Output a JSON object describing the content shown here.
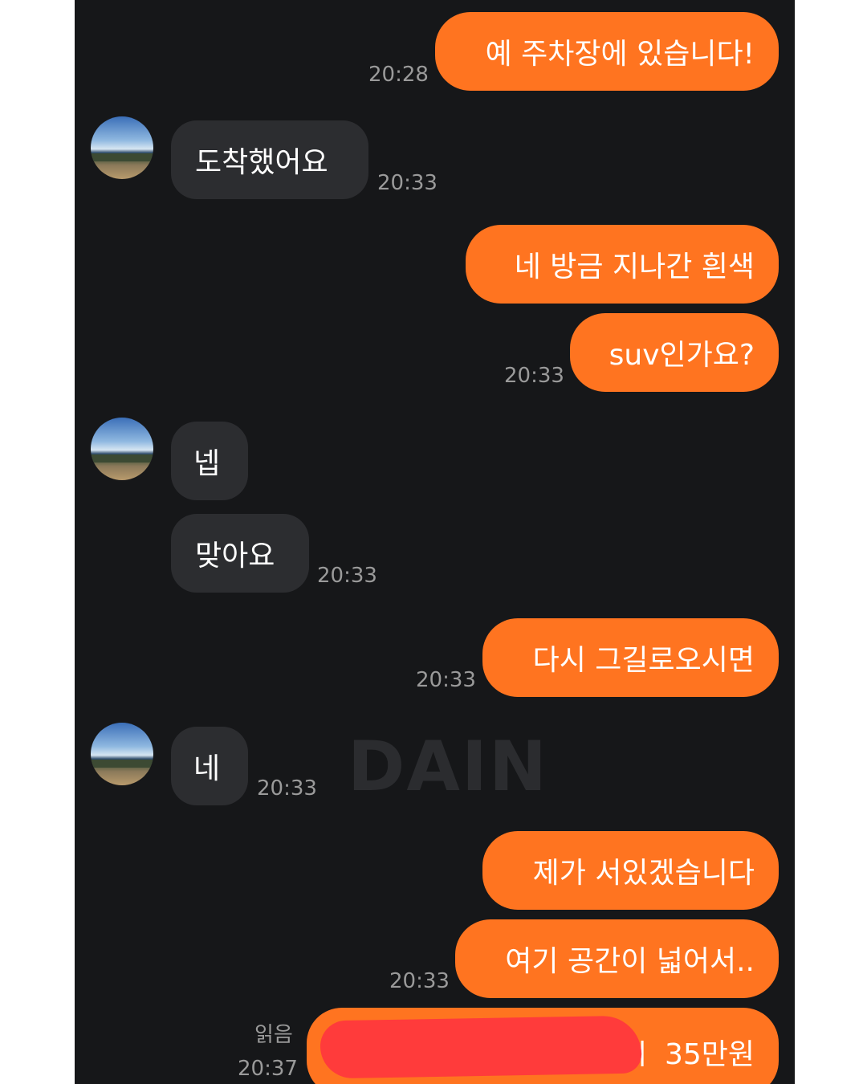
{
  "messages": {
    "m1": {
      "text": "예 주차장에 있습니다!",
      "time": "20:28"
    },
    "m2": {
      "text": "도착했어요",
      "time": "20:33"
    },
    "m3": {
      "text": "네 방금 지나간 흰색"
    },
    "m4": {
      "text": "suv인가요?",
      "time": "20:33"
    },
    "m5": {
      "text": "넵"
    },
    "m6": {
      "text": "맞아요",
      "time": "20:33"
    },
    "m7": {
      "text": "다시 그길로오시면",
      "time": "20:33"
    },
    "m8": {
      "text": "네",
      "time": "20:33"
    },
    "m9": {
      "text": "제가 서있겠습니다"
    },
    "m10": {
      "text": "여기 공간이 넓어서..",
      "time": "20:33"
    },
    "m11": {
      "text": "ㅣ 35만원",
      "time": "20:37",
      "read_label": "읽음"
    }
  },
  "watermark": "DAIN",
  "colors": {
    "outgoing_bubble": "#ff7420",
    "incoming_bubble": "#2c2d30",
    "background": "#161719",
    "redaction": "#ff3b3b"
  },
  "icons": {
    "avatar": "profile-photo-landscape"
  }
}
